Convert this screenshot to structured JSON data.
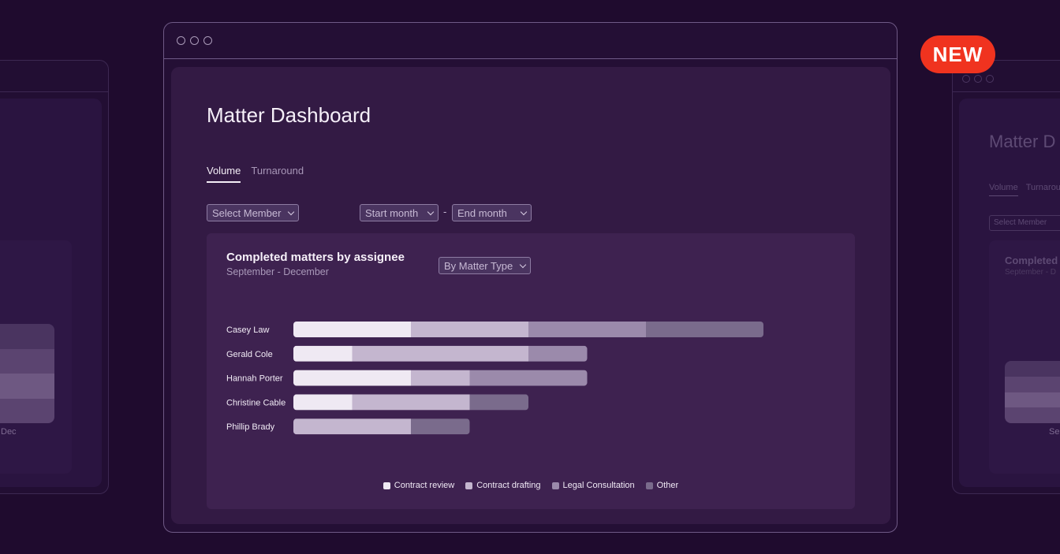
{
  "ghost_left": {
    "axis_label": "Dec",
    "bar_colors": [
      "#4a3460",
      "#5b4470",
      "#6e5882",
      "#5b4470"
    ]
  },
  "ghost_right": {
    "title": "Matter D",
    "tabs": [
      "Volume",
      "Turnarou"
    ],
    "select_label": "Select Member",
    "card_title": "Completed",
    "card_subtitle": "September - D",
    "axis_label": "Se",
    "bar_colors": [
      "#4a3460",
      "#5b4470",
      "#6e5882",
      "#5b4470"
    ]
  },
  "badge": {
    "label": "NEW",
    "color": "#f0331f"
  },
  "page": {
    "title": "Matter Dashboard",
    "tabs": [
      {
        "label": "Volume",
        "active": true
      },
      {
        "label": "Turnaround",
        "active": false
      }
    ],
    "filters": {
      "member": "Select Member",
      "start_month": "Start month",
      "range_separator": "-",
      "end_month": "End month"
    }
  },
  "card": {
    "title": "Completed matters by assignee",
    "subtitle": "September - December",
    "breakdown": "By Matter Type"
  },
  "chart_data": {
    "type": "bar",
    "orientation": "horizontal",
    "stacked": true,
    "categories": [
      "Casey Law",
      "Gerald Cole",
      "Hannah Porter",
      "Christine Cable",
      "Phillip Brady"
    ],
    "series": [
      {
        "name": "Contract review",
        "color": "#efe9f3",
        "values": [
          2,
          1,
          2,
          1,
          0
        ]
      },
      {
        "name": "Contract drafting",
        "color": "#c4b6cf",
        "values": [
          2,
          3,
          1,
          2,
          2
        ]
      },
      {
        "name": "Legal Consultation",
        "color": "#9b8aab",
        "values": [
          2,
          1,
          2,
          0,
          0
        ]
      },
      {
        "name": "Other",
        "color": "#7a6b8c",
        "values": [
          2,
          0,
          0,
          1,
          1
        ]
      }
    ],
    "xlim": [
      0,
      8
    ],
    "grid": false,
    "legend_position": "bottom"
  }
}
